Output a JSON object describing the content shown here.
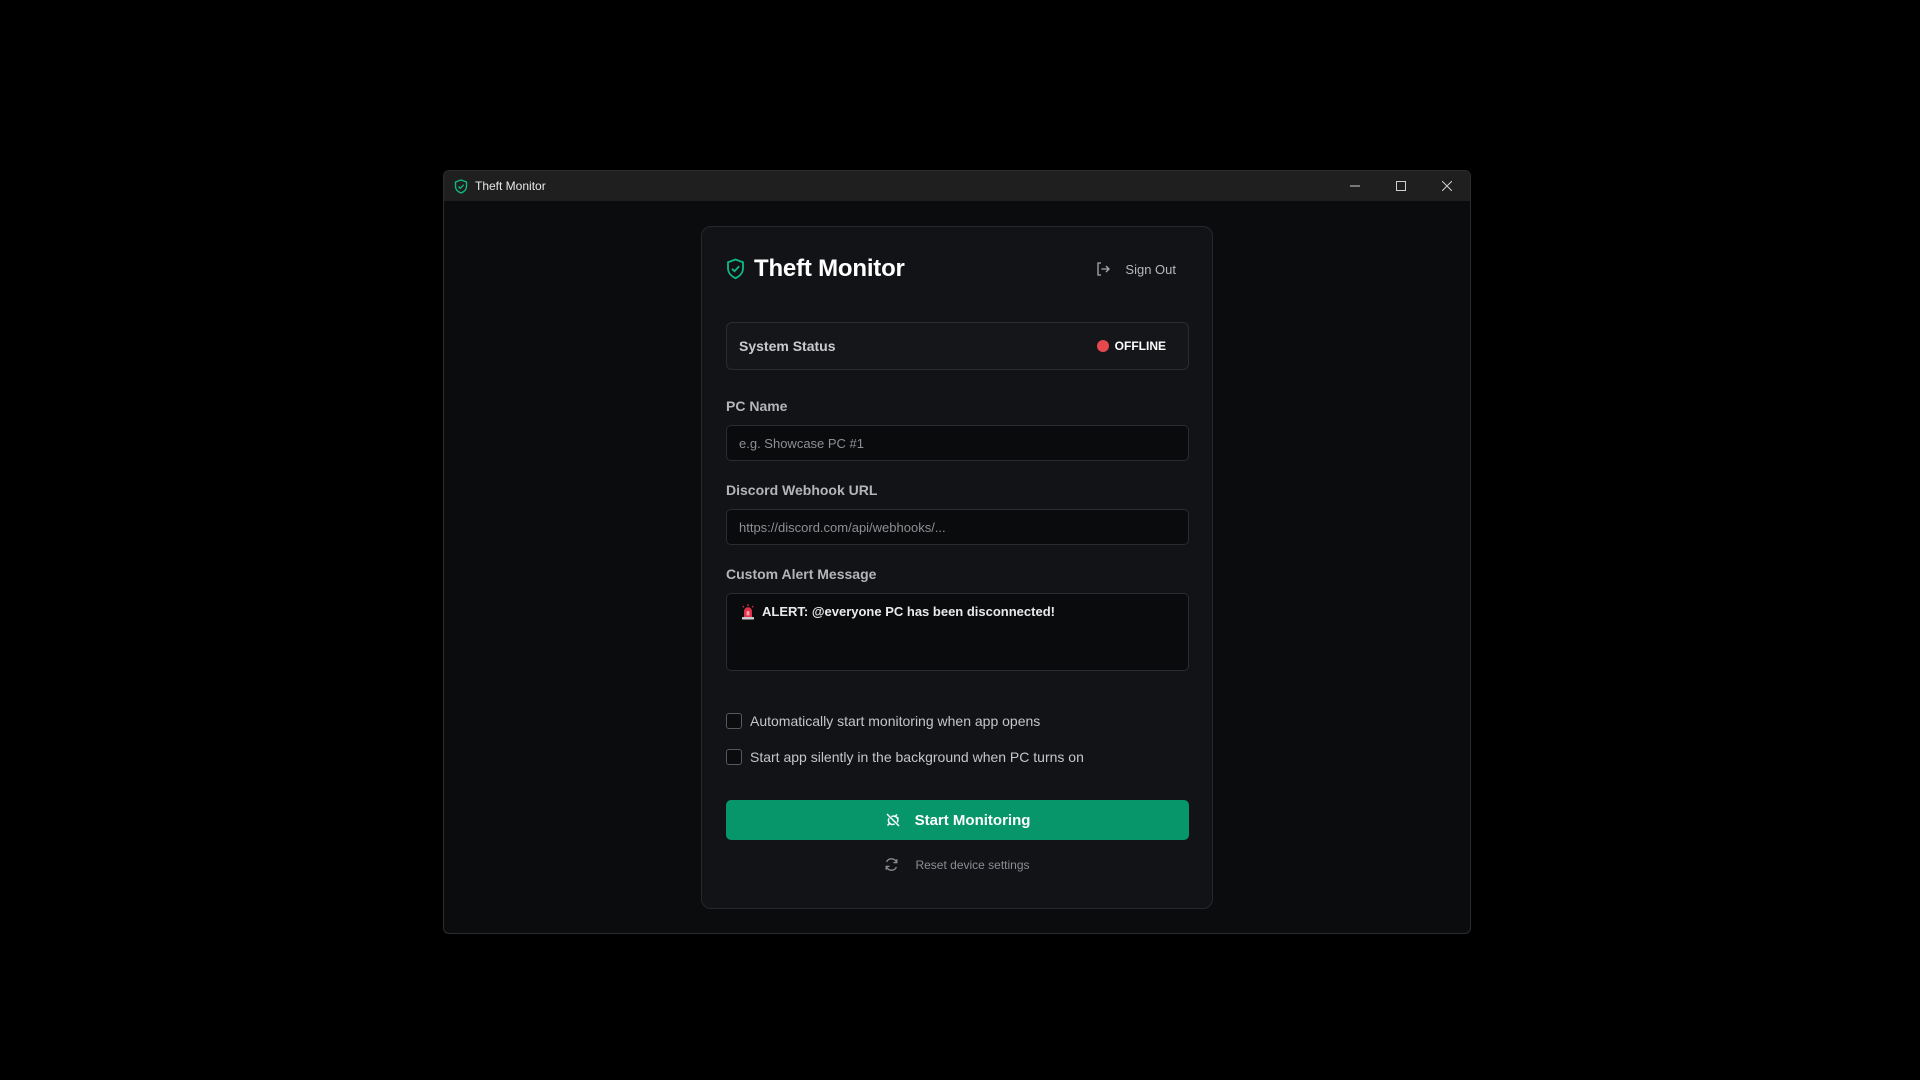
{
  "window": {
    "title": "Theft Monitor",
    "title_icon": "shield-check-icon",
    "controls": [
      "minimize-icon",
      "maximize-icon",
      "close-icon"
    ]
  },
  "header": {
    "title": "Theft Monitor",
    "brand_icon": "shield-check-icon",
    "sign_out_label": "Sign Out"
  },
  "status": {
    "label": "System Status",
    "value": "OFFLINE",
    "color": "#e5484d"
  },
  "form": {
    "pc_name": {
      "label": "PC Name",
      "placeholder": "e.g. Showcase PC #1",
      "value": ""
    },
    "webhook": {
      "label": "Discord Webhook URL",
      "placeholder": "https://discord.com/api/webhooks/...",
      "value": ""
    },
    "alert_message": {
      "label": "Custom Alert Message",
      "value": "ALERT: @everyone PC has been disconnected!",
      "emoji": "siren-icon"
    }
  },
  "options": [
    {
      "label": "Automatically start monitoring when app opens",
      "checked": false
    },
    {
      "label": "Start app silently in the background when PC turns on",
      "checked": false
    }
  ],
  "actions": {
    "start_label": "Start Monitoring",
    "start_color": "#06966a",
    "reset_label": "Reset device settings"
  },
  "colors": {
    "accent": "#06966a",
    "background": "#0b0c0e",
    "card": "#121316"
  }
}
